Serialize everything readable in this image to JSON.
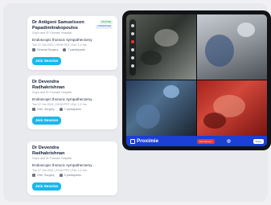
{
  "sessions": [
    {
      "name": "Dr Antigoni Samuelsson Papadimitrakopoulos",
      "hospital": "Guy's and St Thomas' Hospital",
      "procedure": "Endoscopic thoracic sympathectomy",
      "when": "Tue 27 Oct 2021 | 09:00 PST | Est. 1-2 hrs",
      "specialty": "General Surgery",
      "participants": "7 participants",
      "join_label": "Join Session",
      "badges": [
        "INVITED",
        "OBSERVER"
      ]
    },
    {
      "name": "Dr Devendra Radhakrishnan",
      "hospital": "Guy's and St Thomas' Hospital",
      "procedure": "Endoscopic thoracic sympathectomy",
      "when": "Tue 27 Oct 2021 | 09:00 PST | Est. 1-2 hrs",
      "specialty": "Orth. Surgery",
      "participants": "7 participants",
      "join_label": "Join Session"
    },
    {
      "name": "Dr Devendra Radhakrishnan",
      "hospital": "Guy's and St Thomas' Hospital",
      "procedure": "Endoscopic thoracic sympathectomy",
      "when": "Tue 27 Oct 2021 | 10:00 PST | Est. 1-2 hrs",
      "specialty": "Orth. Surgery",
      "participants": "9 participants",
      "join_label": "Join Session"
    }
  ],
  "tablet": {
    "brand": "Proximie",
    "end_label": "End Session",
    "share_label": "Share"
  },
  "colors": {
    "accent": "#19b8ea",
    "brand_bar": "#1c3fd6",
    "end": "#e53935"
  }
}
